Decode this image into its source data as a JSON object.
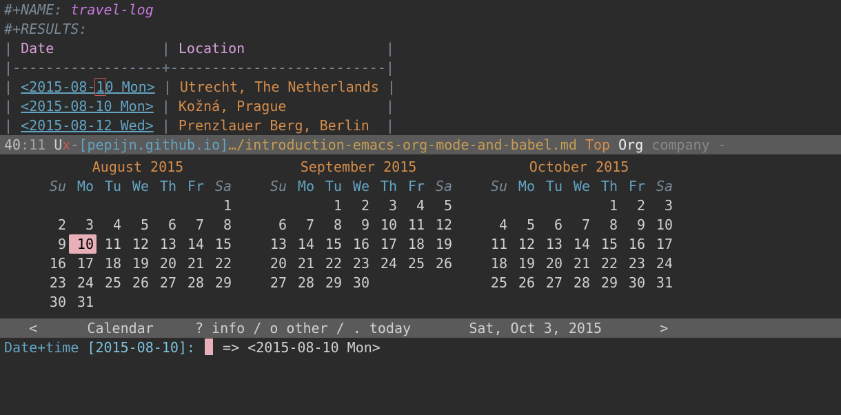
{
  "org": {
    "name_kw": "#+NAME:",
    "name_val": "travel-log",
    "results_kw": "#+RESULTS:",
    "hdr_date": "Date",
    "hdr_loc": "Location",
    "rows": [
      {
        "pre": "<2015-08-",
        "cur": "1",
        "post": "0 Mon>",
        "loc": "Utrecht, The Netherlands",
        "cursor": true
      },
      {
        "pre": "<2015-08-10 Mon>",
        "cur": "",
        "post": "",
        "loc": "Kožná, Prague",
        "cursor": false
      },
      {
        "pre": "<2015-08-12 Wed>",
        "cur": "",
        "post": "",
        "loc": "Prenzlauer Berg, Berlin",
        "cursor": false
      }
    ]
  },
  "modeline": {
    "line": "40",
    "col": ":11",
    "flags": " U",
    "x": "x",
    "dash": "-",
    "proj": "[pepijn.github.io]",
    "elide": "…/",
    "file": "introduction-emacs-org-mode-and-babel.md",
    "top": "Top",
    "mode": "Org",
    "minor": "company -"
  },
  "calendars": [
    {
      "title": "August 2015",
      "lead": 6,
      "days": 31,
      "hl": 10
    },
    {
      "title": "September 2015",
      "lead": 2,
      "days": 30
    },
    {
      "title": "October 2015",
      "lead": 4,
      "days": 31
    }
  ],
  "dow": [
    "Su",
    "Mo",
    "Tu",
    "We",
    "Th",
    "Fr",
    "Sa"
  ],
  "cal_modeline": {
    "left": "<",
    "name": "Calendar",
    "help": "? info / o other / . today",
    "date": "Sat, Oct 3, 2015",
    "right": ">"
  },
  "minibuffer": {
    "prompt": "Date+time ",
    "bracket": "[2015-08-10]: ",
    "arrow": "=> ",
    "result": "<2015-08-10 Mon>"
  }
}
